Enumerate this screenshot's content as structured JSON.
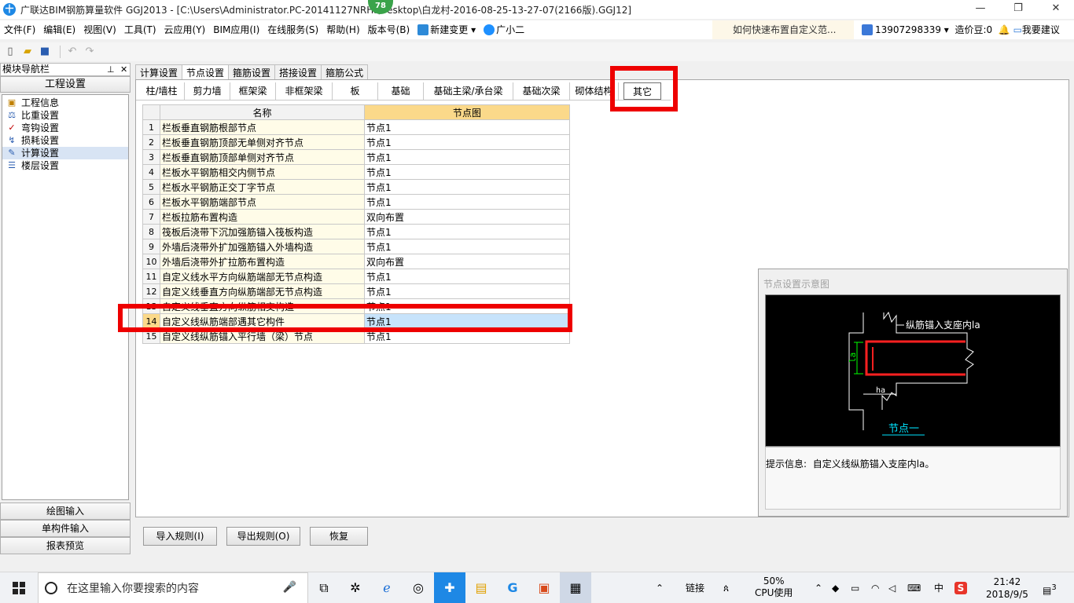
{
  "window": {
    "title": "广联达BIM钢筋算量软件 GGJ2013 - [C:\\Users\\Administrator.PC-20141127NRHI\\Desktop\\白龙村-2016-08-25-13-27-07(2166版).GGJ12]",
    "badge": "78"
  },
  "menu": {
    "items": [
      "文件(F)",
      "编辑(E)",
      "视图(V)",
      "工具(T)",
      "云应用(Y)",
      "BIM应用(I)",
      "在线服务(S)",
      "帮助(H)",
      "版本号(B)"
    ],
    "new_change": "新建变更",
    "guangxiaoer": "广小二",
    "promo": "如何快速布置自定义范...",
    "user_phone": "13907298339",
    "cost_beans": "造价豆:0",
    "suggest": "我要建议"
  },
  "nav": {
    "header": "模块导航栏",
    "section": "工程设置",
    "tree": [
      "工程信息",
      "比重设置",
      "弯钩设置",
      "损耗设置",
      "计算设置",
      "楼层设置"
    ],
    "bottom": [
      "绘图输入",
      "单构件输入",
      "报表预览"
    ]
  },
  "tabs": {
    "top": [
      "计算设置",
      "节点设置",
      "箍筋设置",
      "搭接设置",
      "箍筋公式"
    ],
    "sub": [
      "柱/墙柱",
      "剪力墙",
      "框架梁",
      "非框架梁",
      "板",
      "基础",
      "基础主梁/承台梁",
      "基础次梁",
      "砌体结构",
      "其它"
    ]
  },
  "table": {
    "headers": [
      "名称",
      "节点图"
    ],
    "rows": [
      {
        "no": "1",
        "name": "栏板垂直钢筋根部节点",
        "value": "节点1"
      },
      {
        "no": "2",
        "name": "栏板垂直钢筋顶部无单侧对齐节点",
        "value": "节点1"
      },
      {
        "no": "3",
        "name": "栏板垂直钢筋顶部单侧对齐节点",
        "value": "节点1"
      },
      {
        "no": "4",
        "name": "栏板水平钢筋相交内侧节点",
        "value": "节点1"
      },
      {
        "no": "5",
        "name": "栏板水平钢筋正交丁字节点",
        "value": "节点1"
      },
      {
        "no": "6",
        "name": "栏板水平钢筋端部节点",
        "value": "节点1"
      },
      {
        "no": "7",
        "name": "栏板拉筋布置构造",
        "value": "双向布置"
      },
      {
        "no": "8",
        "name": "筏板后浇带下沉加强筋锚入筏板构造",
        "value": "节点1"
      },
      {
        "no": "9",
        "name": "外墙后浇带外扩加强筋锚入外墙构造",
        "value": "节点1"
      },
      {
        "no": "10",
        "name": "外墙后浇带外扩拉筋布置构造",
        "value": "双向布置"
      },
      {
        "no": "11",
        "name": "自定义线水平方向纵筋端部无节点构造",
        "value": "节点1"
      },
      {
        "no": "12",
        "name": "自定义线垂直方向纵筋端部无节点构造",
        "value": "节点1"
      },
      {
        "no": "13",
        "name": "自定义线垂直方向纵筋相交构造",
        "value": "节点1"
      },
      {
        "no": "14",
        "name": "自定义线纵筋端部遇其它构件",
        "value": "节点1"
      },
      {
        "no": "15",
        "name": "自定义线纵筋锚入平行墙（梁）节点",
        "value": "节点1"
      }
    ]
  },
  "preview": {
    "title": "节点设置示意图",
    "diagram_label_top": "纵筋锚入支座内la",
    "dim_la": "la",
    "dim_ha": "ha",
    "node_name": "节点一",
    "info_label": "提示信息:",
    "info_text": "自定义线纵筋锚入支座内la。"
  },
  "buttons": {
    "import": "导入规则(I)",
    "export": "导出规则(O)",
    "restore": "恢复"
  },
  "taskbar": {
    "search_placeholder": "在这里输入你要搜索的内容",
    "link": "链接",
    "cpu_percent": "50%",
    "cpu_label": "CPU使用",
    "ime": "中",
    "time": "21:42",
    "date": "2018/9/5",
    "notifications": "3"
  },
  "colors": {
    "highlight_red": "#ee0000",
    "header_orange": "#fbd98a",
    "selected_blue": "#c7e3fb",
    "diagram_red": "#ff2020"
  }
}
